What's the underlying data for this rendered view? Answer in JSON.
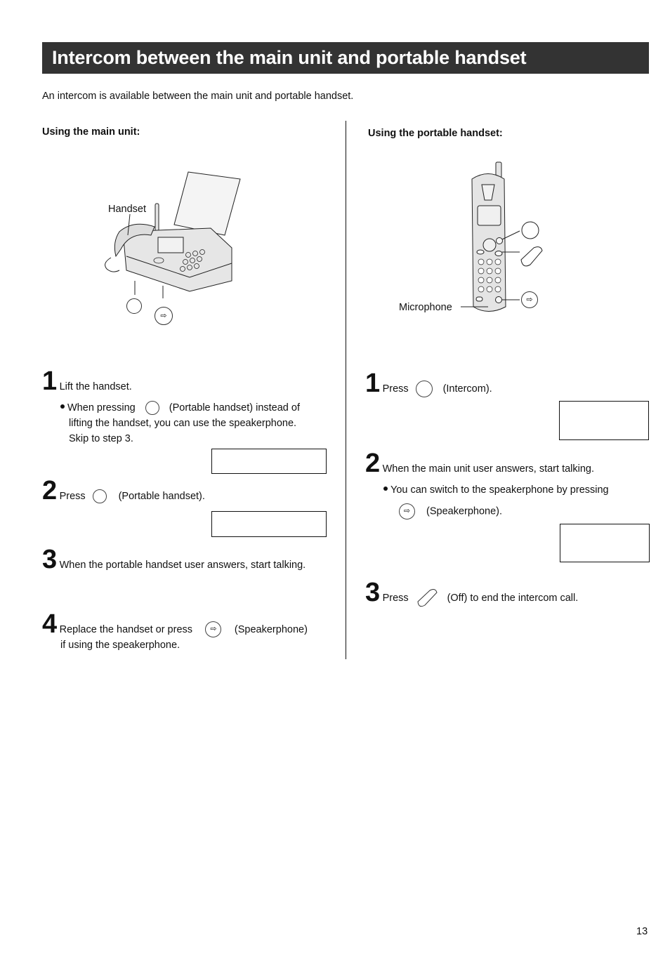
{
  "header": {
    "title": "Intercom between the main unit and portable handset"
  },
  "intro": "An intercom is available between the main unit and portable handset.",
  "left": {
    "heading": "Using the main unit:",
    "figure": {
      "handset_label": "Handset",
      "buttons": [
        "portable-handset-button",
        "speakerphone-button"
      ]
    },
    "steps": [
      {
        "num": "1",
        "text": "Lift the handset.",
        "note_prefix": "When pressing",
        "note_suffix": "(Portable handset) instead of",
        "note_line2": "lifting the handset, you can use the speakerphone.",
        "note_line3": "Skip to step 3."
      },
      {
        "num": "2",
        "prefix": "Press",
        "suffix": "(Portable handset)."
      },
      {
        "num": "3",
        "text": "When the portable handset user answers, start talking."
      },
      {
        "num": "4",
        "prefix": "Replace the handset or press",
        "suffix": "(Speakerphone)",
        "line2": "if using the speakerphone."
      }
    ]
  },
  "right": {
    "heading": "Using the portable handset:",
    "figure": {
      "microphone_label": "Microphone",
      "buttons": [
        "intercom-button",
        "off-button",
        "speakerphone-button"
      ]
    },
    "steps": [
      {
        "num": "1",
        "prefix": "Press",
        "suffix": "(Intercom)."
      },
      {
        "num": "2",
        "text": "When the main unit user answers, start talking.",
        "note": "You can switch to the speakerphone by pressing",
        "note_suffix": "(Speakerphone)."
      },
      {
        "num": "3",
        "prefix": "Press",
        "suffix": "(Off) to end the intercom call."
      }
    ]
  },
  "speaker_glyph": "⇨",
  "page_number": "13"
}
